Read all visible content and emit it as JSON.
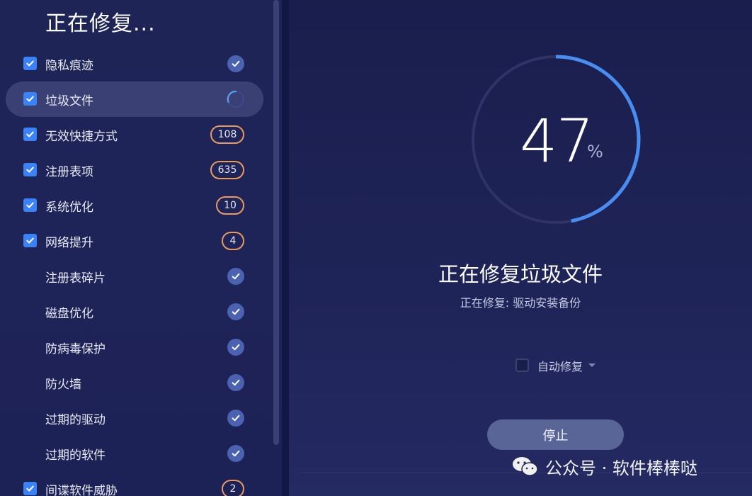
{
  "left": {
    "title": "正在修复...",
    "items": [
      {
        "label": "隐私痕迹",
        "checked": true,
        "status": "done"
      },
      {
        "label": "垃圾文件",
        "checked": true,
        "status": "loading",
        "active": true
      },
      {
        "label": "无效快捷方式",
        "checked": true,
        "status": "count",
        "count": "108"
      },
      {
        "label": "注册表项",
        "checked": true,
        "status": "count",
        "count": "635"
      },
      {
        "label": "系统优化",
        "checked": true,
        "status": "count",
        "count": "10"
      },
      {
        "label": "网络提升",
        "checked": true,
        "status": "count",
        "count": "4"
      },
      {
        "label": "注册表碎片",
        "checked": false,
        "status": "done"
      },
      {
        "label": "磁盘优化",
        "checked": false,
        "status": "done"
      },
      {
        "label": "防病毒保护",
        "checked": false,
        "status": "done"
      },
      {
        "label": "防火墙",
        "checked": false,
        "status": "done"
      },
      {
        "label": "过期的驱动",
        "checked": false,
        "status": "done"
      },
      {
        "label": "过期的软件",
        "checked": false,
        "status": "done"
      },
      {
        "label": "间谍软件威胁",
        "checked": true,
        "status": "count",
        "count": "2"
      }
    ]
  },
  "progress": {
    "value": "47",
    "unit": "%",
    "fraction": 0.47
  },
  "main": {
    "title": "正在修复垃圾文件",
    "subtitle": "正在修复: 驱动安装备份",
    "auto_repair_label": "自动修复",
    "stop_label": "停止"
  },
  "watermark": {
    "text": "公众号 · 软件棒棒哒"
  },
  "colors": {
    "accent": "#3b82f6",
    "badge_border": "#e79a63",
    "done_circle": "#4a62b0",
    "ring_progress": "#4a8df0",
    "ring_track": "#2f3468"
  }
}
